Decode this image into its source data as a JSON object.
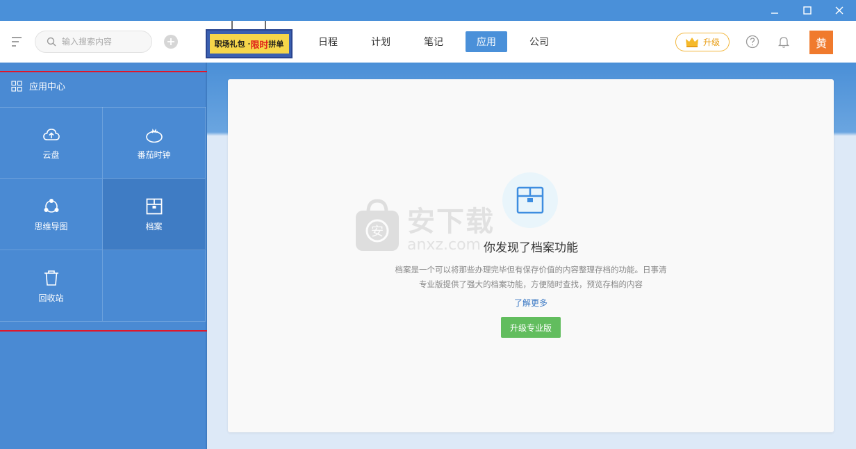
{
  "window": {
    "icons": [
      "minimize-icon",
      "maximize-icon",
      "close-icon"
    ]
  },
  "header": {
    "search_placeholder": "输入搜索内容",
    "banner": {
      "part1": "职场礼包 · ",
      "part2": "限时",
      "part3": "拼单"
    },
    "tabs": [
      {
        "label": "日程"
      },
      {
        "label": "计划"
      },
      {
        "label": "笔记"
      },
      {
        "label": "应用",
        "active": true
      },
      {
        "label": "公司"
      }
    ],
    "upgrade_label": "升级",
    "avatar_text": "黄",
    "colors": {
      "accent": "#4a90d9",
      "avatar": "#f07a2d",
      "upgrade": "#e89c12"
    }
  },
  "sidebar": {
    "title": "应用中心",
    "apps": [
      {
        "label": "云盘",
        "icon": "cloud-upload-icon"
      },
      {
        "label": "番茄时钟",
        "icon": "tomato-icon"
      },
      {
        "label": "思维导图",
        "icon": "mindmap-icon"
      },
      {
        "label": "档案",
        "icon": "archive-icon",
        "active": true
      },
      {
        "label": "回收站",
        "icon": "trash-icon"
      }
    ]
  },
  "main": {
    "headline": "你发现了档案功能",
    "desc_line1": "档案是一个可以将那些办理完毕但有保存价值的内容整理存档的功能。日事清",
    "desc_line2": "专业版提供了强大的档案功能，方便随时查找，预览存档的内容",
    "learn_more": "了解更多",
    "upgrade_button": "升级专业版",
    "button_color": "#62bd5e"
  },
  "watermark": {
    "cn": "安下载",
    "en": "anxz.com"
  }
}
